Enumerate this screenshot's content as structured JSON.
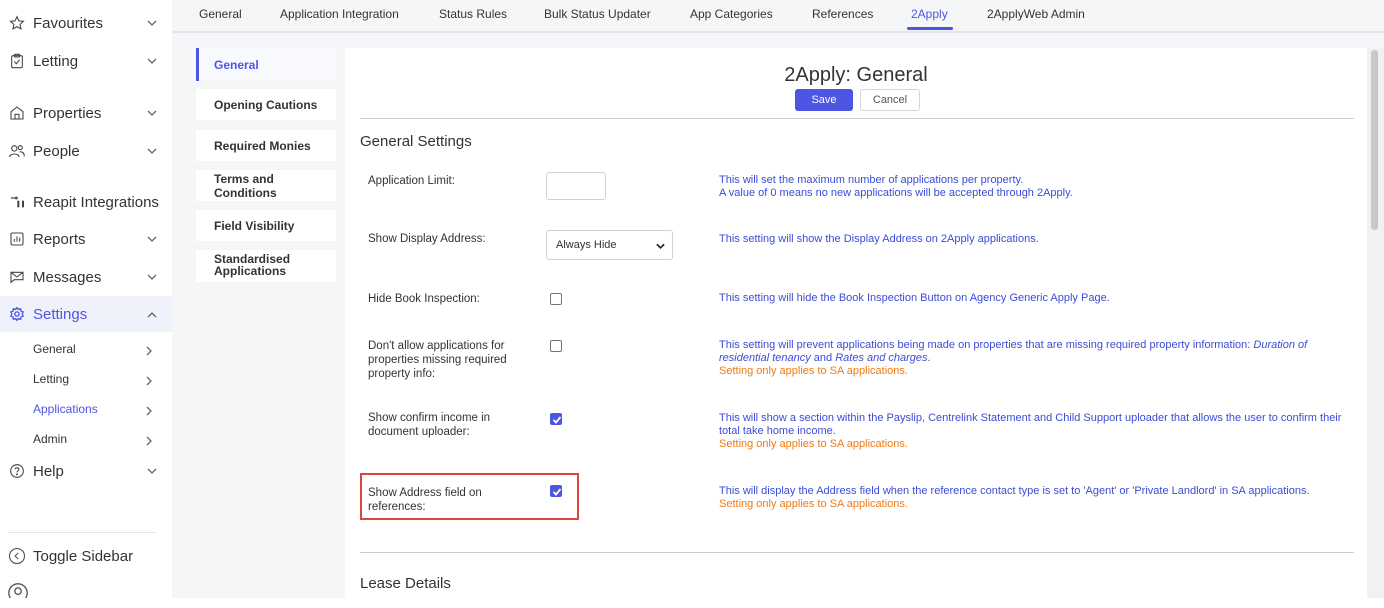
{
  "sidebar": {
    "items": [
      {
        "label": "Favourites",
        "icon": "star-icon",
        "chevron": "down"
      },
      {
        "label": "Letting",
        "icon": "clipboard-icon",
        "chevron": "down"
      },
      {
        "label": "Properties",
        "icon": "home-icon",
        "chevron": "down"
      },
      {
        "label": "People",
        "icon": "people-icon",
        "chevron": "down"
      },
      {
        "label": "Reapit Integrations",
        "icon": "integration-icon",
        "chevron": ""
      },
      {
        "label": "Reports",
        "icon": "reports-icon",
        "chevron": "down"
      },
      {
        "label": "Messages",
        "icon": "messages-icon",
        "chevron": "down"
      },
      {
        "label": "Settings",
        "icon": "gear-icon",
        "chevron": "up",
        "active": true
      },
      {
        "label": "Help",
        "icon": "help-icon",
        "chevron": "down"
      }
    ],
    "settings_sub": [
      {
        "label": "General"
      },
      {
        "label": "Letting"
      },
      {
        "label": "Applications",
        "active": true
      },
      {
        "label": "Admin"
      }
    ],
    "toggle_label": "Toggle Sidebar"
  },
  "tabs": [
    {
      "label": "General"
    },
    {
      "label": "Application Integration"
    },
    {
      "label": "Status Rules"
    },
    {
      "label": "Bulk Status Updater"
    },
    {
      "label": "App Categories"
    },
    {
      "label": "References"
    },
    {
      "label": "2Apply",
      "active": true
    },
    {
      "label": "2ApplyWeb Admin"
    }
  ],
  "subnav": [
    {
      "label": "General",
      "active": true
    },
    {
      "label": "Opening Cautions"
    },
    {
      "label": "Required Monies"
    },
    {
      "label": "Terms and Conditions"
    },
    {
      "label": "Field Visibility"
    },
    {
      "label": "Standardised Applications"
    }
  ],
  "page": {
    "title": "2Apply: General",
    "save_label": "Save",
    "cancel_label": "Cancel",
    "section_general": "General Settings",
    "section_lease": "Lease Details"
  },
  "settings": {
    "application_limit": {
      "label": "Application Limit:",
      "value": "",
      "help1": "This will set the maximum number of applications per property.",
      "help2": "A value of 0 means no new applications will be accepted through 2Apply."
    },
    "show_display_address": {
      "label": "Show Display Address:",
      "selected": "Always Hide",
      "help": "This setting will show the Display Address on 2Apply applications."
    },
    "hide_book_inspection": {
      "label": "Hide Book Inspection:",
      "checked": false,
      "help": "This setting will hide the Book Inspection Button on Agency Generic Apply Page."
    },
    "dont_allow_missing": {
      "label": "Don't allow applications for properties missing required property info:",
      "checked": false,
      "help_a": "This setting will prevent applications being made on properties that are missing required property information: ",
      "help_em1": "Duration of residential tenancy",
      "help_and": " and ",
      "help_em2": "Rates and charges",
      "help_end": ".",
      "warn": "Setting only applies to SA applications."
    },
    "confirm_income": {
      "label": "Show confirm income in document uploader:",
      "checked": true,
      "help": "This will show a section within the Payslip, Centrelink Statement and Child Support uploader that allows the user to confirm their total take home income.",
      "warn": "Setting only applies to SA applications."
    },
    "address_field_refs": {
      "label": "Show Address field on references:",
      "checked": true,
      "help": "This will display the Address field when the reference contact type is set to 'Agent' or 'Private Landlord' in SA applications.",
      "warn": "Setting only applies to SA applications."
    }
  },
  "colors": {
    "accent": "#4d55e3",
    "help_text": "#3b4cd8",
    "warn_text": "#f07a12",
    "highlight_border": "#e0443e"
  }
}
